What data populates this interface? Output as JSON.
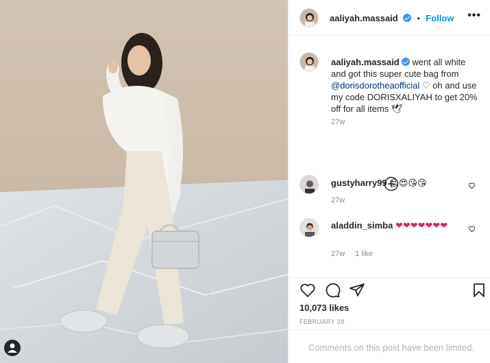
{
  "post": {
    "author": "aaliyah.massaid",
    "follow_label": "Follow",
    "dot": "•",
    "more_label": "•••",
    "caption_pre": "went all white and got this super cute bag from ",
    "caption_mention": "@dorisdorotheaofficial",
    "caption_post": " ♡ oh and use my code DORISXALIYAH to get 20% off for all items 🕊",
    "caption_time": "27w",
    "likes": "10,073 likes",
    "date": "FEBRUARY 28",
    "comments_disabled": "Comments on this post have been limited."
  },
  "comments": [
    {
      "user": "gustyharry99",
      "emoji": "😍😍😘😘",
      "time": "27w",
      "likes": ""
    },
    {
      "user": "aladdin_simba",
      "emoji": "❤❤❤❤❤❤❤",
      "time": "27w",
      "likes": "1 like"
    }
  ],
  "icons": {
    "like": "heart-icon",
    "comment": "comment-icon",
    "share": "paper-plane-icon",
    "save": "bookmark-icon",
    "load_more": "plus-circle-icon",
    "tag": "user-tag-icon"
  },
  "colors": {
    "accent": "#0095f6",
    "verified": "#3897f0",
    "heart": "#e0245e",
    "muted": "#8e8e8e"
  }
}
